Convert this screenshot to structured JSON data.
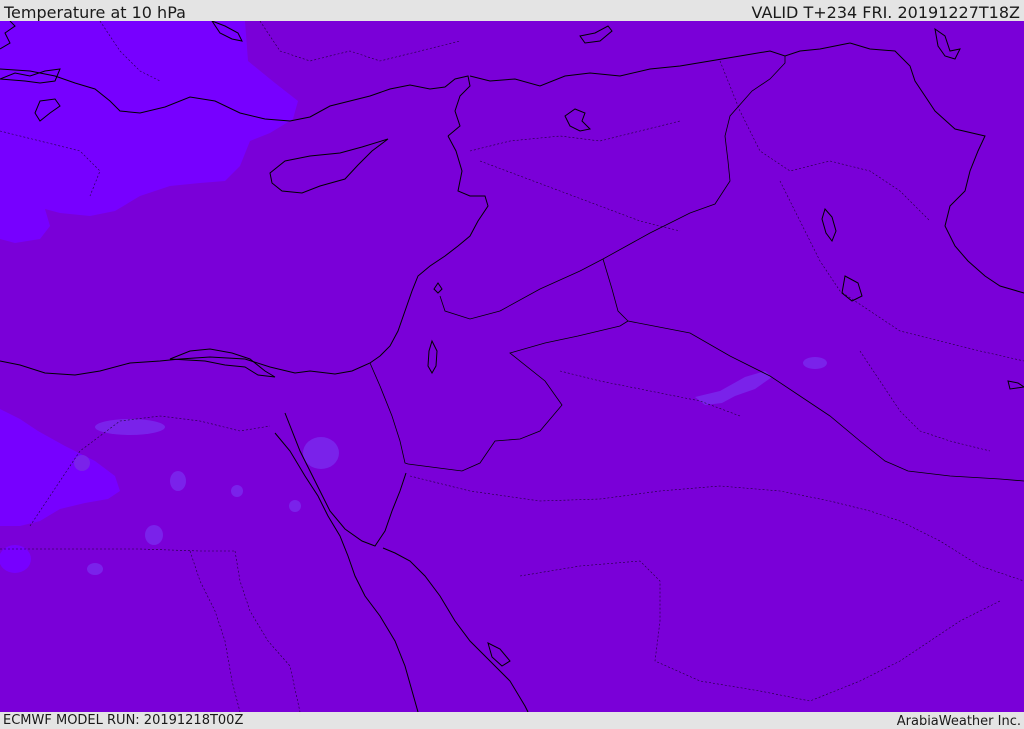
{
  "header": {
    "title": "Temperature at 10 hPa",
    "valid_time": "VALID T+234 FRI. 20191227T18Z"
  },
  "footer": {
    "model_run": "ECMWF MODEL RUN: 20191218T00Z",
    "credit": "ArabiaWeather Inc."
  },
  "map": {
    "field": "Temperature at 10 hPa",
    "colors": {
      "base_fill": "#7a00d8",
      "cold_fill": "#7700ff",
      "coastline": "#000000",
      "border": "#000000"
    }
  }
}
